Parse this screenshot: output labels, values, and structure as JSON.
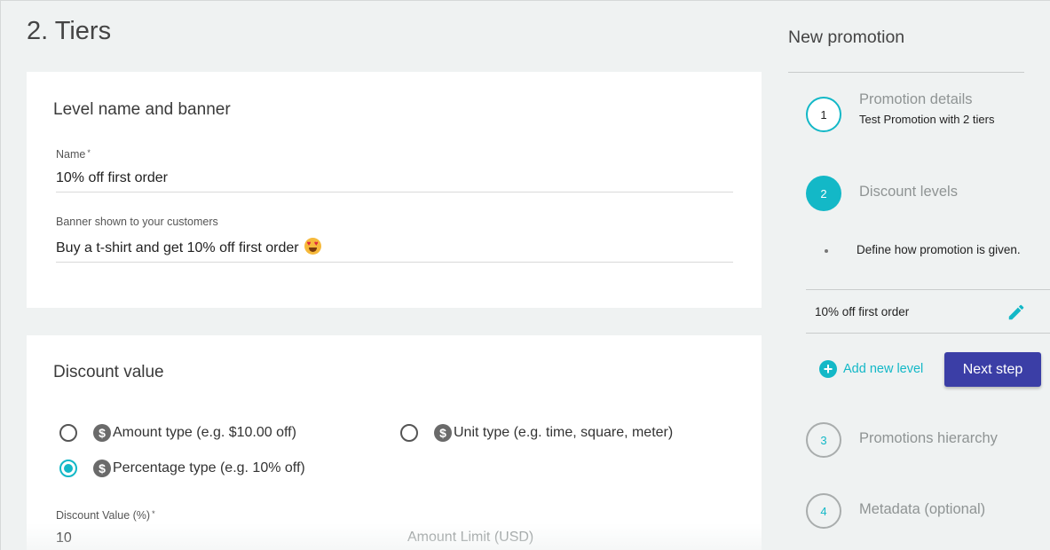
{
  "page": {
    "title": "2. Tiers"
  },
  "level_card": {
    "title": "Level name and banner",
    "name_label": "Name",
    "required_mark": "*",
    "name_value": "10% off first order",
    "banner_label": "Banner shown to your customers",
    "banner_value": "Buy a t-shirt and get 10% off first order",
    "banner_emoji": "smiling-face-with-heart-eyes-icon"
  },
  "discount_card": {
    "title": "Discount value",
    "options": [
      {
        "label": "Amount type (e.g. $10.00 off)",
        "checked": false
      },
      {
        "label": "Unit type (e.g. time, square, meter)",
        "checked": false
      },
      {
        "label": "Percentage type (e.g. 10% off)",
        "checked": true
      }
    ],
    "option_icon": "dollar-icon",
    "discount_value_label": "Discount Value (%)",
    "discount_value": "10",
    "amount_limit_label": "Amount Limit (USD)"
  },
  "sidebar": {
    "title": "New promotion",
    "steps": [
      {
        "number": "1",
        "title": "Promotion details",
        "subtitle": "Test Promotion with 2 tiers",
        "state": "done"
      },
      {
        "number": "2",
        "title": "Discount levels",
        "state": "active",
        "bullet": "Define how promotion is given."
      },
      {
        "number": "3",
        "title": "Promotions hierarchy",
        "state": "pending"
      },
      {
        "number": "4",
        "title": "Metadata (optional)",
        "state": "pending"
      }
    ],
    "level_item": {
      "name": "10% off first order",
      "icon": "pencil-icon"
    },
    "add_level_label": "Add new level",
    "add_icon": "plus-icon",
    "next_button": "Next step"
  },
  "colors": {
    "accent": "#13b8c7",
    "primary_button": "#3b3ea6",
    "background": "#eff2f2"
  }
}
